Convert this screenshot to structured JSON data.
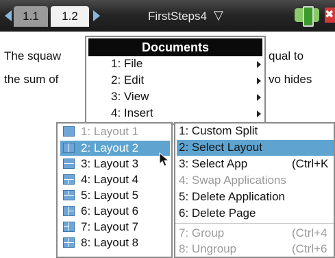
{
  "header": {
    "tabs": [
      {
        "label": "1.1"
      },
      {
        "label": "1.2"
      }
    ],
    "document_title": "FirstSteps4",
    "icons": {
      "prev": "left-arrow-icon",
      "next": "right-arrow-icon",
      "dropdown": "chevron-down-icon",
      "battery": "battery-icon",
      "close": "close-icon"
    }
  },
  "document": {
    "line1_left": "The squaw",
    "line1_right": "qual to",
    "line2_left": "the sum of",
    "line2_right": "vo hides"
  },
  "documents_menu": {
    "title": "Documents",
    "items": [
      {
        "label": "1: File"
      },
      {
        "label": "2: Edit"
      },
      {
        "label": "3: View"
      },
      {
        "label": "4: Insert"
      }
    ]
  },
  "layouts_menu": {
    "items": [
      {
        "label": "1: Layout 1",
        "state": "disabled"
      },
      {
        "label": "2: Layout 2",
        "state": "selected"
      },
      {
        "label": "3: Layout 3",
        "state": "normal"
      },
      {
        "label": "4: Layout 4",
        "state": "normal"
      },
      {
        "label": "5: Layout 5",
        "state": "normal"
      },
      {
        "label": "6: Layout 6",
        "state": "normal"
      },
      {
        "label": "7: Layout 7",
        "state": "normal"
      },
      {
        "label": "8: Layout 8",
        "state": "normal"
      }
    ]
  },
  "page_layout_menu": {
    "items": [
      {
        "label": "1: Custom Split",
        "shortcut": "",
        "state": "normal"
      },
      {
        "label": "2: Select Layout",
        "shortcut": "",
        "state": "selected"
      },
      {
        "label": "3: Select App",
        "shortcut": "(Ctrl+K",
        "state": "normal"
      },
      {
        "label": "4: Swap Applications",
        "shortcut": "",
        "state": "disabled"
      },
      {
        "label": "5: Delete Application",
        "shortcut": "",
        "state": "normal"
      },
      {
        "label": "6: Delete Page",
        "shortcut": "",
        "state": "normal"
      },
      {
        "label": "7: Group",
        "shortcut": "(Ctrl+4",
        "state": "disabled"
      },
      {
        "label": "8: Ungroup",
        "shortcut": "(Ctrl+6",
        "state": "disabled"
      }
    ]
  },
  "colors": {
    "selection": "#5fa4d0",
    "topbar": "#1b1b1b",
    "layout_icon": "#6ea6d8",
    "disabled_text": "#9a9a9a"
  }
}
